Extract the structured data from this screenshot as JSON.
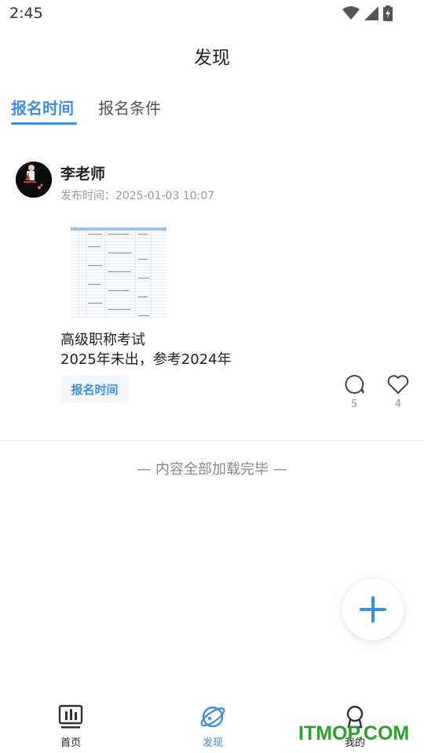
{
  "status_bar": {
    "time": "2:45"
  },
  "header": {
    "title": "发现"
  },
  "tabs": [
    {
      "label": "报名时间",
      "active": true
    },
    {
      "label": "报名条件",
      "active": false
    }
  ],
  "post": {
    "author": "李老师",
    "time": "发布时间：2025-01-03 10:07",
    "text_line1": "高级职称考试",
    "text_line2": "2025年未出，参考2024年",
    "tag": "报名时间",
    "comments": "5",
    "likes": "4"
  },
  "footer_text": "— 内容全部加载完毕 —",
  "bottom_nav": [
    {
      "label": "首页",
      "icon": "home-icon"
    },
    {
      "label": "发现",
      "icon": "discover-icon",
      "active": true
    },
    {
      "label": "我的",
      "icon": "profile-icon"
    }
  ],
  "watermark": "ITMOP.COM",
  "colors": {
    "accent": "#3a8ee6",
    "tag_bg": "#f3f6fb",
    "watermark": "#2f9e2f"
  }
}
